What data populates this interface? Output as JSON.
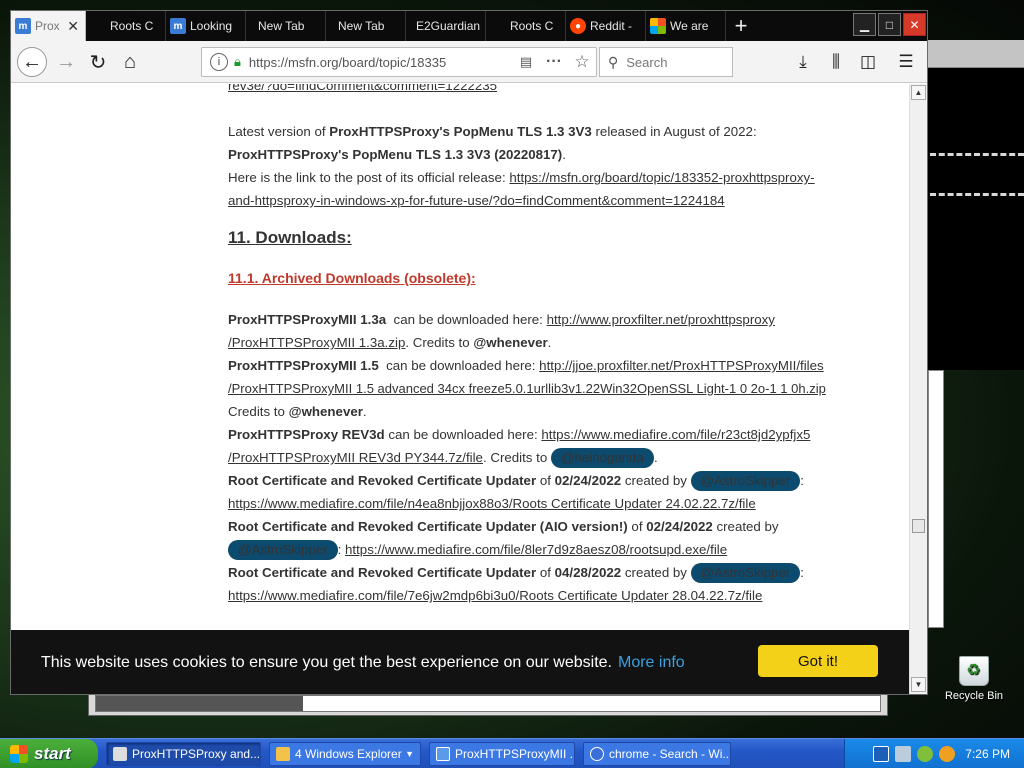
{
  "browser": {
    "tabs": [
      {
        "label": "Prox",
        "active": true,
        "icon": "msfn-favicon"
      },
      {
        "label": "Roots C",
        "icon": "none"
      },
      {
        "label": "Looking",
        "icon": "msfn-favicon"
      },
      {
        "label": "New Tab",
        "icon": "none"
      },
      {
        "label": "New Tab",
        "icon": "none"
      },
      {
        "label": "E2Guardian",
        "icon": "none"
      },
      {
        "label": "Roots C",
        "icon": "none"
      },
      {
        "label": "Reddit -",
        "icon": "reddit-favicon"
      },
      {
        "label": "We are",
        "icon": "microsoft-favicon"
      }
    ],
    "new_tab": "+",
    "url": "https://msfn.org/board/topic/18335",
    "search_placeholder": "Search"
  },
  "article": {
    "top_link": "rev3e/?do=findComment&comment=1222235",
    "latest_prefix": "Latest version of ",
    "latest_name": "ProxHTTPSProxy's PopMenu TLS 1.3 3V3",
    "latest_suffix": " released in August of 2022:",
    "latest_version": "ProxHTTPSProxy's PopMenu TLS 1.3 3V3 (20220817)",
    "link_intro": "Here is the link to the post of its official release: ",
    "release_link_1": "https://msfn.org/board/topic/183352-proxhttpsproxy-",
    "release_link_2": "and-httpsproxy-in-windows-xp-for-future-use/?do=findComment&comment=1224184",
    "downloads_heading": "11. Downloads:",
    "archived_heading": "11.1. Archived Downloads (obsolete):",
    "dl1_name": "ProxHTTPSProxyMII 1.3a",
    "dl1_text": "  can be downloaded here: ",
    "dl1_link_1": "http://www.proxfilter.net/proxhttpsproxy",
    "dl1_link_2": "/ProxHTTPSProxyMII 1.3a.zip",
    "dl1_credits": ". Credits to ",
    "dl1_user": "@whenever",
    "dl2_name": "ProxHTTPSProxyMII 1.5",
    "dl2_text": "  can be downloaded here: ",
    "dl2_link_1": "http://jjoe.proxfilter.net/ProxHTTPSProxyMII/files",
    "dl2_link_2": "/ProxHTTPSProxyMII 1.5 advanced 34cx freeze5.0.1urllib3v1.22Win32OpenSSL Light-1 0 2o-1 1 0h.zip",
    "dl2_credits": "Credits to ",
    "dl2_user": "@whenever",
    "dl3_name": "ProxHTTPSProxy REV3d",
    "dl3_text": " can be downloaded here: ",
    "dl3_link_1": "https://www.mediafire.com/file/r23ct8jd2ypfjx5",
    "dl3_link_2": "/ProxHTTPSProxyMII REV3d PY344.7z/file",
    "dl3_credits": ". Credits to ",
    "dl3_user": "@heinoganda",
    "dl4_name": "Root Certificate and Revoked Certificate Updater",
    "dl4_of": " of ",
    "dl4_date": "02/24/2022",
    "dl4_by": " created by ",
    "dl4_user": "@AstroSkipper",
    "dl4_link": "https://www.mediafire.com/file/n4ea8nbjjox88o3/Roots Certificate Updater 24.02.22.7z/file",
    "dl5_name": "Root Certificate and Revoked Certificate Updater (AIO version!)",
    "dl5_of": " of ",
    "dl5_date": "02/24/2022",
    "dl5_by": " created by",
    "dl5_user": "@AstroSkipper",
    "dl5_link": "https://www.mediafire.com/file/8ler7d9z8aesz08/rootsupd.exe/file",
    "dl6_name": "Root Certificate and Revoked Certificate Updater",
    "dl6_of": " of ",
    "dl6_date": "04/28/2022",
    "dl6_by": " created by ",
    "dl6_user": "@AstroSkipper",
    "dl6_link": "https://www.mediafire.com/file/7e6jw2mdp6bi3u0/Roots Certificate Updater 28.04.22.7z/file"
  },
  "cookie_banner": {
    "text": "This website uses cookies to ensure you get the best experience on our website.",
    "more": "More info",
    "button": "Got it!"
  },
  "desktop": {
    "recycle_bin": "Recycle Bin"
  },
  "taskbar": {
    "start": "start",
    "tasks": [
      {
        "label": "ProxHTTPSProxy and..."
      },
      {
        "label": "4 Windows Explorer"
      },
      {
        "label": "ProxHTTPSProxyMII ..."
      },
      {
        "label": "chrome - Search - Wi..."
      }
    ],
    "clock": "7:26 PM"
  },
  "colors": {
    "accent_heading": "#c0392b",
    "user_pill": "#0c4a6e",
    "cookie_button": "#f2d118",
    "cookie_link": "#3aa0e0"
  }
}
